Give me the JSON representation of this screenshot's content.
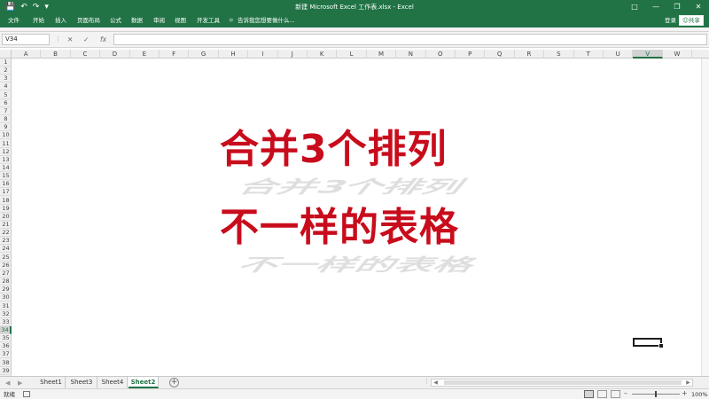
{
  "window": {
    "title": "新建 Microsoft Excel 工作表.xlsx - Excel",
    "qat_icons": [
      "save-icon",
      "undo-icon",
      "redo-icon",
      "customize-icon"
    ],
    "controls": [
      "ribbon-options-icon",
      "minimize-icon",
      "restore-icon",
      "close-icon"
    ]
  },
  "ribbon": {
    "tabs": [
      "文件",
      "开始",
      "插入",
      "页面布局",
      "公式",
      "数据",
      "审阅",
      "视图",
      "开发工具"
    ],
    "tell_me": "告诉我您想要做什么...",
    "login": "登录",
    "share": "共享"
  },
  "formula_bar": {
    "name_box": "V34",
    "fx_label": "fx",
    "content": ""
  },
  "grid": {
    "columns": [
      "A",
      "B",
      "C",
      "D",
      "E",
      "F",
      "G",
      "H",
      "I",
      "J",
      "K",
      "L",
      "M",
      "N",
      "O",
      "P",
      "Q",
      "R",
      "S",
      "T",
      "U",
      "V",
      "W"
    ],
    "rows": [
      "1",
      "2",
      "3",
      "4",
      "5",
      "6",
      "7",
      "8",
      "9",
      "10",
      "11",
      "12",
      "13",
      "14",
      "15",
      "16",
      "17",
      "18",
      "19",
      "20",
      "21",
      "22",
      "23",
      "24",
      "25",
      "26",
      "27",
      "28",
      "29",
      "30",
      "31",
      "32",
      "33",
      "34",
      "35",
      "36",
      "37",
      "38",
      "39"
    ],
    "active_cell": "V34",
    "active_column": "V",
    "active_row": "34"
  },
  "overlay": {
    "line1": "合并3个排列",
    "line2": "不一样的表格",
    "color": "#c80c1c"
  },
  "sheet_tabs": {
    "tabs": [
      "Sheet1",
      "Sheet3",
      "Sheet4",
      "Sheet2"
    ],
    "active": "Sheet2"
  },
  "status_bar": {
    "ready": "就绪",
    "zoom": "100%"
  },
  "colors": {
    "accent": "#217346",
    "title_text": "#c80c1c"
  }
}
